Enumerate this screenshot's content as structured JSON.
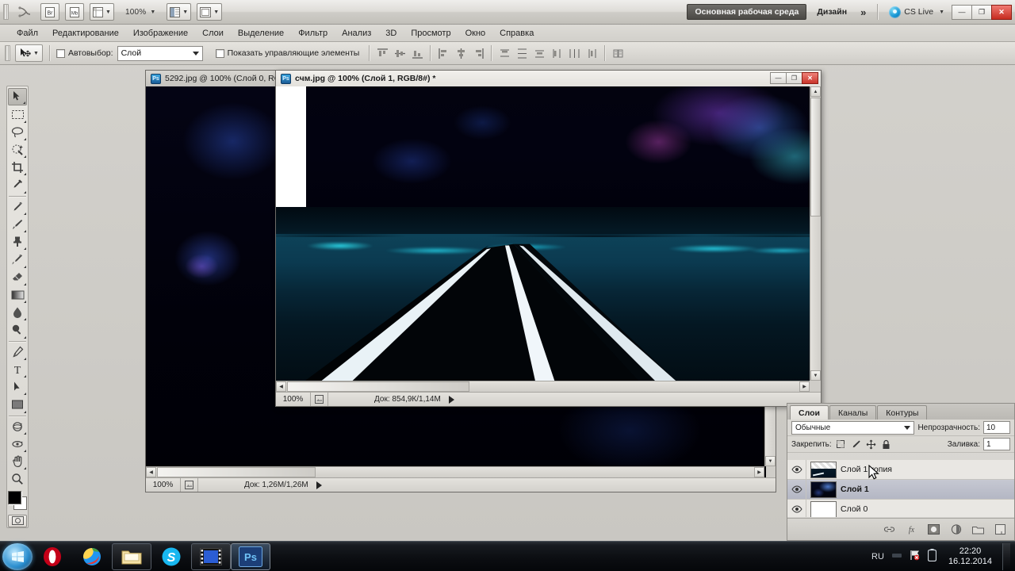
{
  "app": {
    "zoom_level": "100%",
    "workspace_active": "Основная рабочая среда",
    "workspace_other": "Дизайн",
    "workspace_more": "»",
    "cs_live": "CS Live",
    "win_minimize": "—",
    "win_restore": "❐",
    "win_close": "✕"
  },
  "menu": {
    "items": [
      {
        "label": "Файл"
      },
      {
        "label": "Редактирование"
      },
      {
        "label": "Изображение"
      },
      {
        "label": "Слои"
      },
      {
        "label": "Выделение"
      },
      {
        "label": "Фильтр"
      },
      {
        "label": "Анализ"
      },
      {
        "label": "3D"
      },
      {
        "label": "Просмотр"
      },
      {
        "label": "Окно"
      },
      {
        "label": "Справка"
      }
    ]
  },
  "options_bar": {
    "tool_icon": "move-tool-icon",
    "autoselect_label": "Автовыбор:",
    "autoselect_value": "Слой",
    "show_controls_label": "Показать управляющие элементы"
  },
  "toolbox": {
    "tools": [
      {
        "name": "move-tool",
        "active": true
      },
      {
        "name": "rectangular-marquee-tool",
        "active": false
      },
      {
        "name": "lasso-tool",
        "active": false
      },
      {
        "name": "quick-selection-tool",
        "active": false
      },
      {
        "name": "crop-tool",
        "active": false
      },
      {
        "name": "eyedropper-tool",
        "active": false
      },
      {
        "name": "healing-brush-tool",
        "active": false
      },
      {
        "name": "brush-tool",
        "active": false
      },
      {
        "name": "clone-stamp-tool",
        "active": false
      },
      {
        "name": "history-brush-tool",
        "active": false
      },
      {
        "name": "eraser-tool",
        "active": false
      },
      {
        "name": "gradient-tool",
        "active": false
      },
      {
        "name": "blur-tool",
        "active": false
      },
      {
        "name": "dodge-tool",
        "active": false
      },
      {
        "name": "pen-tool",
        "active": false
      },
      {
        "name": "type-tool",
        "active": false
      },
      {
        "name": "path-selection-tool",
        "active": false
      },
      {
        "name": "rectangle-shape-tool",
        "active": false
      },
      {
        "name": "rotate-3d-tool",
        "active": false
      },
      {
        "name": "orbit-3d-camera-tool",
        "active": false
      },
      {
        "name": "hand-tool",
        "active": false
      },
      {
        "name": "zoom-tool",
        "active": false
      }
    ],
    "foreground_color": "#000000",
    "background_color": "#ffffff"
  },
  "documents": [
    {
      "title": "5292.jpg @ 100% (Слой 0, RG",
      "active": false,
      "status_zoom": "100%",
      "status_doc": "Док: 1,26М/1,26М"
    },
    {
      "title": "счм.jpg @ 100% (Слой 1, RGB/8#) *",
      "active": true,
      "status_zoom": "100%",
      "status_doc": "Док: 854,9К/1,14М"
    }
  ],
  "layers_panel": {
    "tabs": [
      {
        "label": "Слои",
        "active": true
      },
      {
        "label": "Каналы",
        "active": false
      },
      {
        "label": "Контуры",
        "active": false
      }
    ],
    "blend_mode": "Обычные",
    "opacity_label": "Непрозрачность:",
    "opacity_value": "10",
    "lock_label": "Закрепить:",
    "fill_label": "Заливка:",
    "fill_value": "1",
    "layers": [
      {
        "name": "Слой 1 копия",
        "visible": true,
        "selected": false,
        "thumb": "nebula-road"
      },
      {
        "name": "Слой 1",
        "visible": true,
        "selected": true,
        "thumb": "nebula"
      },
      {
        "name": "Слой 0",
        "visible": true,
        "selected": false,
        "thumb": "white"
      }
    ],
    "footer_icons": [
      "link-layers-icon",
      "layer-styles-fx-icon",
      "add-layer-mask-icon",
      "new-adjustment-layer-icon",
      "new-group-icon",
      "new-layer-icon"
    ]
  },
  "taskbar": {
    "start_label": "start-orb",
    "items": [
      {
        "name": "opera-icon"
      },
      {
        "name": "media-ball-icon"
      },
      {
        "name": "file-explorer-icon"
      },
      {
        "name": "skype-icon"
      },
      {
        "name": "video-player-icon"
      },
      {
        "name": "photoshop-icon"
      }
    ],
    "language": "RU",
    "time": "22:20",
    "date": "16.12.2014"
  }
}
